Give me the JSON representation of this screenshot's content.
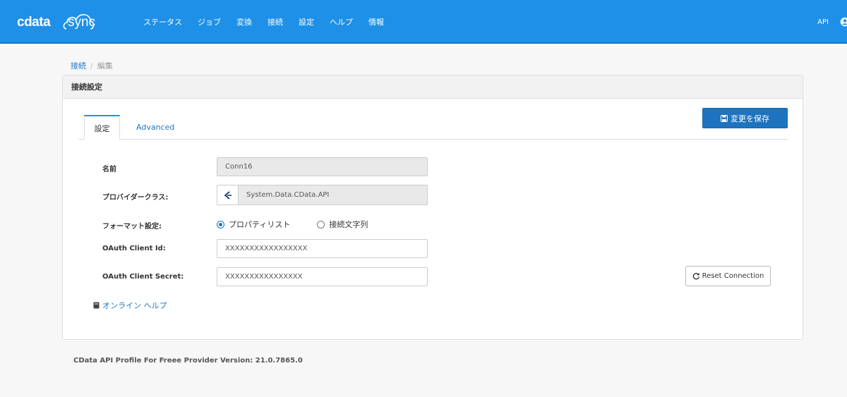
{
  "header": {
    "logo_brand": "cdata",
    "logo_product": "sync",
    "nav": [
      "ステータス",
      "ジョブ",
      "変換",
      "接続",
      "設定",
      "ヘルプ",
      "情報"
    ],
    "api_label": "API"
  },
  "breadcrumb": {
    "parent": "接続",
    "separator": "/",
    "current": "編集"
  },
  "panel": {
    "title": "接続設定",
    "tabs": [
      "設定",
      "Advanced"
    ],
    "save_button": "変更を保存",
    "fields": {
      "name_label": "名前",
      "name_value": "Conn16",
      "provider_label": "プロバイダークラス:",
      "provider_value": "System.Data.CData.API",
      "format_label": "フォーマット設定:",
      "format_options": [
        "プロパティリスト",
        "接続文字列"
      ],
      "format_selected": "プロパティリスト",
      "client_id_label": "OAuth Client Id:",
      "client_id_value": "XXXXXXXXXXXXXXXXX",
      "client_secret_label": "OAuth Client Secret:",
      "client_secret_value": "XXXXXXXXXXXXXXXX"
    },
    "reset_button": "Reset Connection",
    "help_link": "オンライン ヘルプ"
  },
  "footer": {
    "version_text": "CData API Profile For Freee Provider Version: 21.0.7865.0"
  },
  "colors": {
    "topbar": "#1e90e8",
    "primary_button": "#1e73be",
    "link": "#1e77c6"
  },
  "icons": [
    "cloud-icon",
    "user-icon",
    "save-icon",
    "provider-logo-icon",
    "refresh-icon",
    "book-icon"
  ]
}
